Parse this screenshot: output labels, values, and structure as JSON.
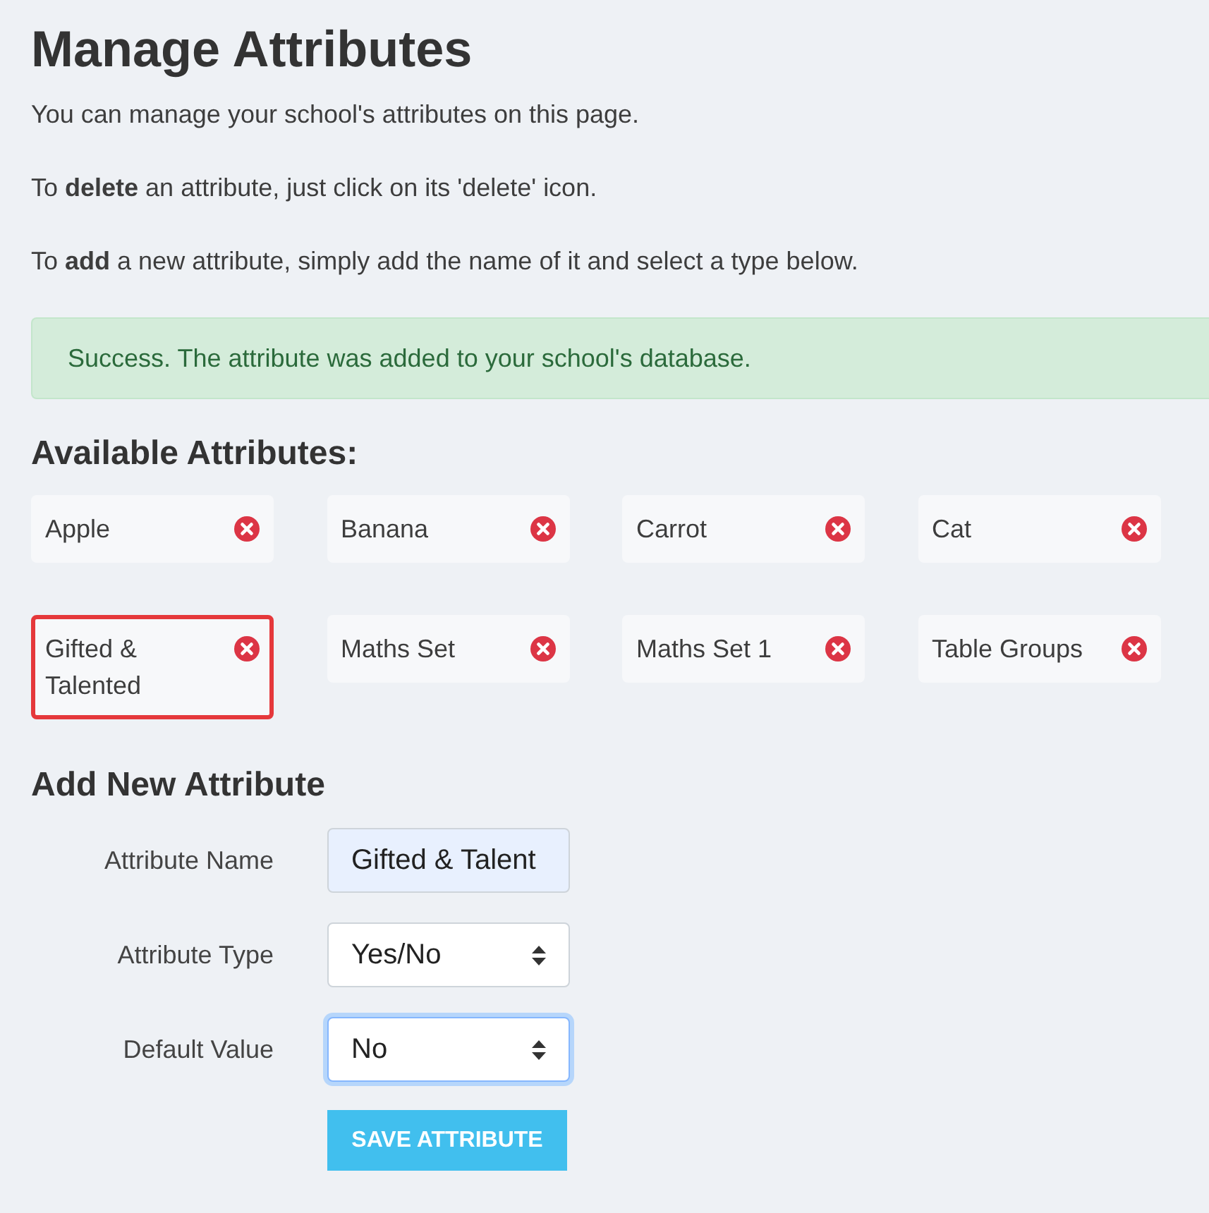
{
  "page": {
    "title": "Manage Attributes",
    "intro": [
      "You can manage your school's attributes on this page.",
      "To **delete** an attribute, just click on its 'delete' icon.",
      "To **add** a new attribute, simply add the name of it and select a type below."
    ]
  },
  "alert": {
    "kind": "success",
    "message": "Success. The attribute was added to your school's database."
  },
  "attributes": {
    "heading": "Available Attributes:",
    "items": [
      {
        "name": "Apple",
        "highlighted": false
      },
      {
        "name": "Banana",
        "highlighted": false
      },
      {
        "name": "Carrot",
        "highlighted": false
      },
      {
        "name": "Cat",
        "highlighted": false
      },
      {
        "name": "Gifted & Talented",
        "highlighted": true
      },
      {
        "name": "Maths Set",
        "highlighted": false
      },
      {
        "name": "Maths Set 1",
        "highlighted": false
      },
      {
        "name": "Table Groups",
        "highlighted": false
      }
    ]
  },
  "form": {
    "heading": "Add New Attribute",
    "fields": [
      {
        "kind": "text",
        "label": "Attribute Name",
        "value": "Gifted & Talent",
        "autofilled": true,
        "focused": false
      },
      {
        "kind": "select",
        "label": "Attribute Type",
        "value": "Yes/No",
        "autofilled": false,
        "focused": false
      },
      {
        "kind": "select",
        "label": "Default Value",
        "value": "No",
        "autofilled": false,
        "focused": true
      }
    ],
    "button": "SAVE ATTRIBUTE"
  }
}
